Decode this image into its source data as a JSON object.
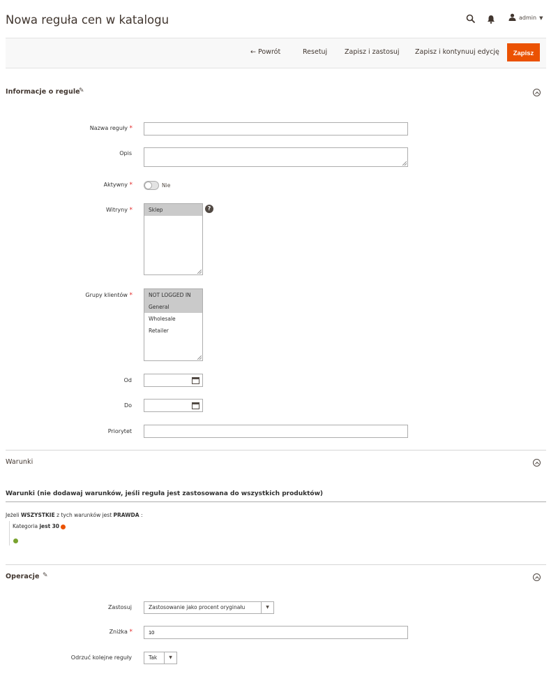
{
  "header": {
    "title": "Nowa reguła cen w katalogu",
    "user_label": "admin"
  },
  "actions": {
    "back": "← Powrót",
    "reset": "Resetuj",
    "save_apply": "Zapisz i zastosuj",
    "save_continue": "Zapisz i kontynuuj edycję",
    "save": "Zapisz"
  },
  "sections": {
    "rule_info": "Informacje o regule",
    "conditions": "Warunki",
    "actions": "Operacje"
  },
  "rule_form": {
    "name_label": "Nazwa reguły",
    "name_value": "",
    "description_label": "Opis",
    "description_value": "",
    "active_label": "Aktywny",
    "active_state": "Nie",
    "websites_label": "Witryny",
    "websites_options": [
      "Sklep"
    ],
    "customer_groups_label": "Grupy klientów",
    "customer_groups_options": [
      "NOT LOGGED IN",
      "General",
      "Wholesale",
      "Retailer"
    ],
    "from_label": "Od",
    "from_value": "",
    "to_label": "Do",
    "to_value": "",
    "priority_label": "Priorytet",
    "priority_value": ""
  },
  "conditions": {
    "heading": "Warunki (nie dodawaj warunków, jeśli reguła jest zastosowana do wszystkich produktów)",
    "if_text": "Jeżeli",
    "aggregator": "WSZYSTKIE",
    "middle_text": "z tych warunków jest",
    "value": "PRAWDA",
    "colon": ":",
    "rule_attribute": "Kategoria",
    "rule_operator": "jest",
    "rule_value": "30"
  },
  "operations": {
    "apply_label": "Zastosuj",
    "apply_value": "Zastosowanie jako procent oryginału",
    "discount_label": "Zniżka",
    "discount_value": "10",
    "discard_label": "Odrzuć kolejne reguły",
    "discard_value": "Tak"
  },
  "colors": {
    "primary": "#eb5202",
    "required": "#e22626",
    "add": "#79a22e"
  },
  "icons": {
    "search": "search-icon",
    "bell": "bell-icon",
    "user": "user-icon",
    "edit": "pencil-icon",
    "collapse": "collapse-icon",
    "calendar": "calendar-icon",
    "help": "help-icon"
  }
}
